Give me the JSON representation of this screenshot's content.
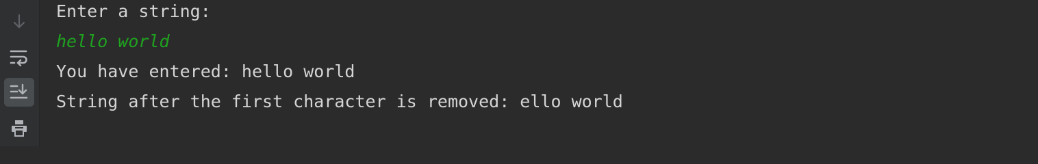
{
  "toolbar": {
    "buttons": [
      {
        "name": "down-arrow-icon",
        "label": "Down",
        "state": "disabled"
      },
      {
        "name": "soft-wrap-icon",
        "label": "Soft-Wrap",
        "state": "normal"
      },
      {
        "name": "scroll-to-end-icon",
        "label": "Scroll to the End",
        "state": "active"
      },
      {
        "name": "print-icon",
        "label": "Print",
        "state": "normal"
      }
    ]
  },
  "console": {
    "lines": [
      {
        "kind": "output",
        "text": "Enter a string:"
      },
      {
        "kind": "user-input",
        "text": "hello world"
      },
      {
        "kind": "output",
        "text": "You have entered: hello world"
      },
      {
        "kind": "output",
        "text": "String after the first character is removed: ello world"
      }
    ]
  },
  "colors": {
    "background": "#2b2b2b",
    "toolbar": "#2f3032",
    "output_text": "#d4d4d4",
    "user_input_text": "#1fa31f",
    "active_button": "#4a4d50",
    "icon": "#b0b3b8",
    "icon_disabled": "#5e6165"
  }
}
